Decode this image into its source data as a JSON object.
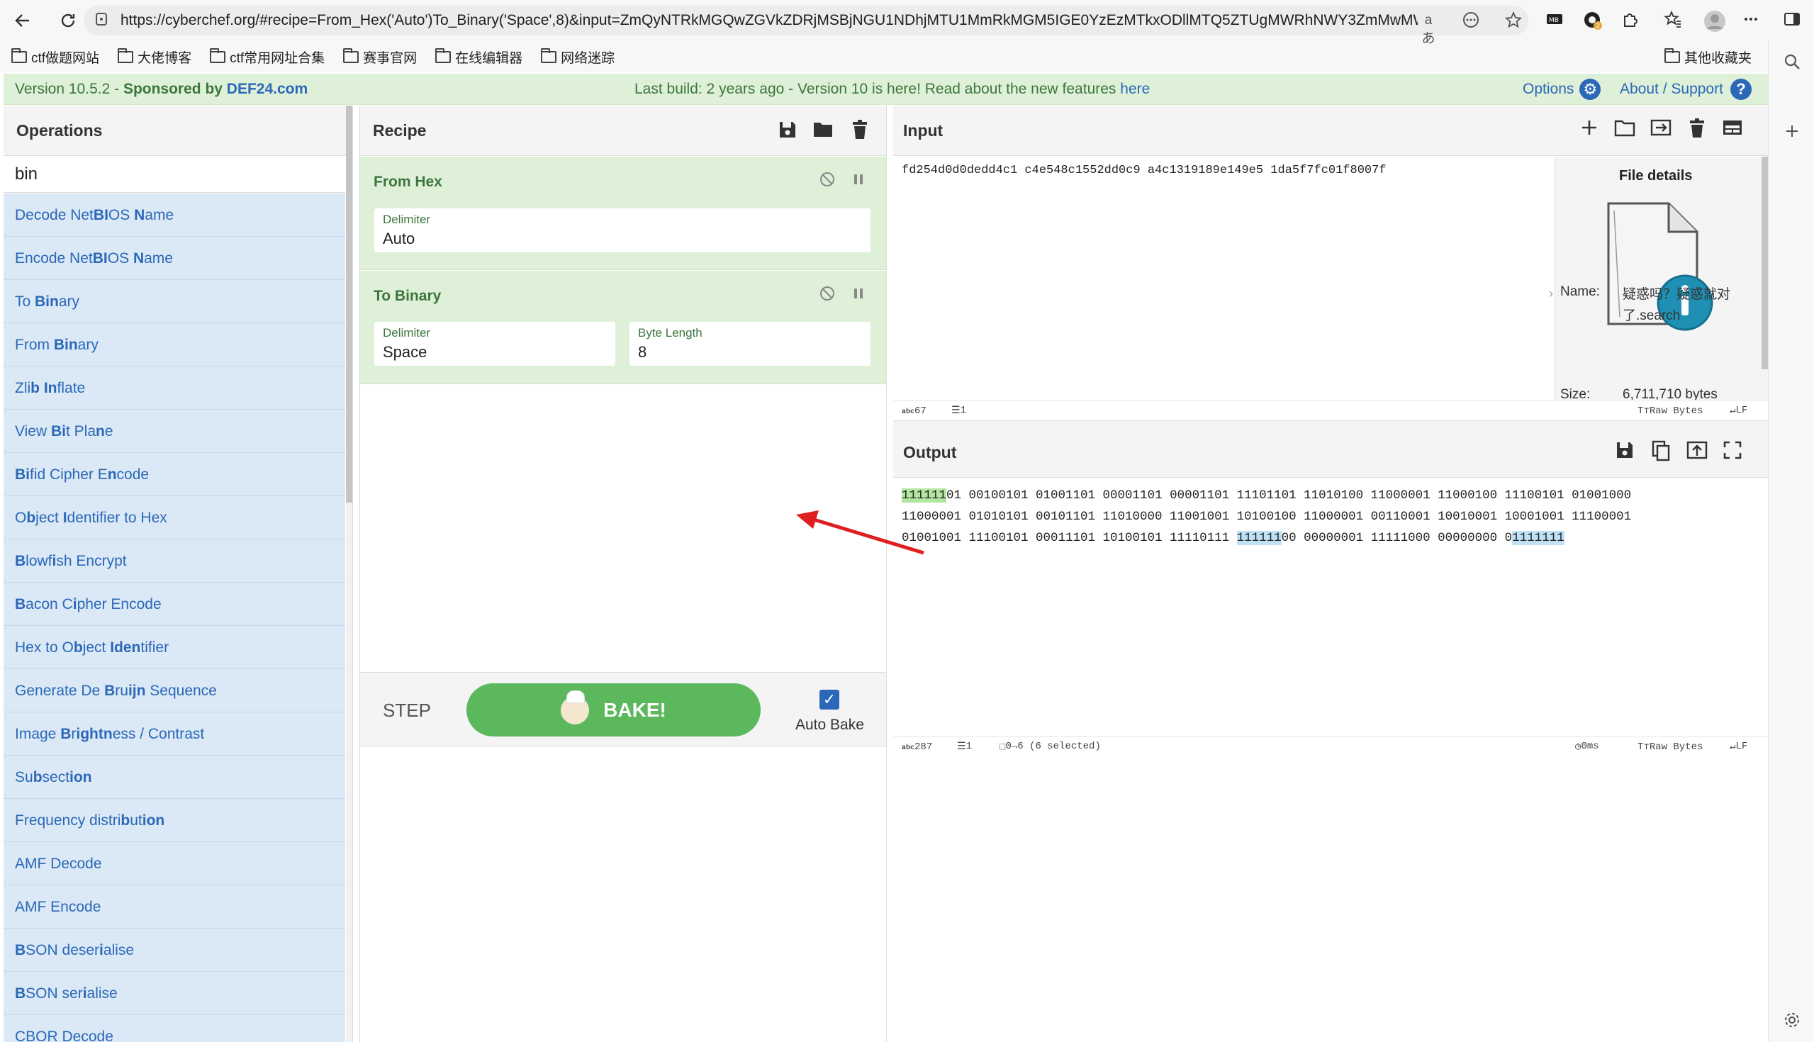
{
  "browser": {
    "url": "https://cyberchef.org/#recipe=From_Hex('Auto')To_Binary('Space',8)&input=ZmQyNTRkMGQwZGVkZDRjMSBjNGU1NDhjMTU1MmRkMGM5IGE0YzEzMTkxODllMTQ5ZTUgMWRhNWY3ZmMwMW...",
    "bookmarks": [
      "ctf做题网站",
      "大佬博客",
      "ctf常用网址合集",
      "赛事官网",
      "在线编辑器",
      "网络迷踪"
    ],
    "other_bookmarks": "其他收藏夹",
    "read_aloud": "aあ"
  },
  "banner": {
    "version": "Version 10.5.2 - ",
    "sponsored": "Sponsored by ",
    "sponsor": "DEF24.com",
    "build_text": "Last build: 2 years ago - Version 10 is here! Read about the new features ",
    "here_link": "here",
    "options": "Options",
    "about": "About / Support"
  },
  "operations": {
    "title": "Operations",
    "search_value": "bin",
    "items": [
      {
        "pre": "Decode Net",
        "b1": "BI",
        "mid": "OS ",
        "b2": "N",
        "post": "ame"
      },
      {
        "pre": "Encode Net",
        "b1": "BI",
        "mid": "OS ",
        "b2": "N",
        "post": "ame"
      },
      {
        "pre": "To ",
        "b1": "Bin",
        "mid": "ary",
        "b2": "",
        "post": ""
      },
      {
        "pre": "From ",
        "b1": "Bin",
        "mid": "ary",
        "b2": "",
        "post": ""
      },
      {
        "pre": "Zli",
        "b1": "b",
        "mid": " ",
        "b2": "In",
        "post": "flate"
      },
      {
        "pre": "View ",
        "b1": "Bi",
        "mid": "t Pla",
        "b2": "n",
        "post": "e"
      },
      {
        "pre": "",
        "b1": "Bi",
        "mid": "fid Cipher E",
        "b2": "n",
        "post": "code"
      },
      {
        "pre": "O",
        "b1": "b",
        "mid": "ject ",
        "b2": "I",
        "post": "dentifier to Hex"
      },
      {
        "pre": "",
        "b1": "B",
        "mid": "lowf",
        "b2": "i",
        "post": "sh Encrypt"
      },
      {
        "pre": "",
        "b1": "B",
        "mid": "acon C",
        "b2": "i",
        "post": "pher Encode"
      },
      {
        "pre": "Hex to O",
        "b1": "b",
        "mid": "ject ",
        "b2": "Iden",
        "post": "tifier"
      },
      {
        "pre": "Generate De ",
        "b1": "B",
        "mid": "ru",
        "b2": "ijn",
        "post": " Sequence"
      },
      {
        "pre": "Image ",
        "b1": "B",
        "mid": "r",
        "b2": "ightn",
        "post": "ess / Contrast"
      },
      {
        "pre": "Su",
        "b1": "b",
        "mid": "sect",
        "b2": "ion",
        "post": ""
      },
      {
        "pre": "Frequency distri",
        "b1": "b",
        "mid": "ut",
        "b2": "ion",
        "post": ""
      },
      {
        "pre": "AMF Decode",
        "b1": "",
        "mid": "",
        "b2": "",
        "post": ""
      },
      {
        "pre": "AMF Encode",
        "b1": "",
        "mid": "",
        "b2": "",
        "post": ""
      },
      {
        "pre": "",
        "b1": "B",
        "mid": "SON deser",
        "b2": "i",
        "post": "alise"
      },
      {
        "pre": "",
        "b1": "B",
        "mid": "SON ser",
        "b2": "i",
        "post": "alise"
      },
      {
        "pre": "CBOR Decode",
        "b1": "",
        "mid": "",
        "b2": "",
        "post": ""
      }
    ]
  },
  "recipe": {
    "title": "Recipe",
    "ops": [
      {
        "name": "From Hex",
        "fields": [
          {
            "label": "Delimiter",
            "value": "Auto"
          }
        ]
      },
      {
        "name": "To Binary",
        "fields": [
          {
            "label": "Delimiter",
            "value": "Space"
          },
          {
            "label": "Byte Length",
            "value": "8"
          }
        ]
      }
    ],
    "step": "STEP",
    "bake": "BAKE!",
    "auto_bake": "Auto Bake",
    "auto_bake_checked": true
  },
  "input": {
    "title": "Input",
    "text": "fd254d0d0dedd4c1 c4e548c1552dd0c9 a4c1319189e149e5 1da5f7fc01f8007f",
    "length": "67",
    "lines": "1",
    "charset": "Raw Bytes",
    "eol": "LF",
    "file_details": {
      "title": "File details",
      "name_label": "Name:",
      "name_value": "疑惑吗？疑惑就对了.search",
      "size_label": "Size:",
      "size_value": "6,711,710 bytes"
    }
  },
  "output": {
    "title": "Output",
    "lines": [
      [
        "",
        "111111",
        "01 00100101 01001101 00001101 00001101 11101101 11010100 11000001 11000100 11100101 01001000",
        "",
        ""
      ],
      [
        "11000001 01010101 00101101 11010000 11001001 10100100 11000001 00110001 10010001 10001001 11100001",
        "",
        "",
        "",
        ""
      ],
      [
        "01001001 11100101 00011101 10100101 11110111 ",
        "",
        "",
        "111111",
        "00 00000001 11111000 00000000 0|1111111"
      ]
    ],
    "length": "287",
    "line_count": "1",
    "selection": "0→6 (6 selected)",
    "time": "0ms",
    "charset": "Raw Bytes",
    "eol": "LF"
  },
  "colors": {
    "banner_bg": "#dff0d8",
    "operation_bg": "#dbe8f5",
    "recipe_op_bg": "#dff0d8",
    "bake_green": "#5cb85c",
    "link_blue": "#2b68b8",
    "arrow_red": "#e02020"
  }
}
